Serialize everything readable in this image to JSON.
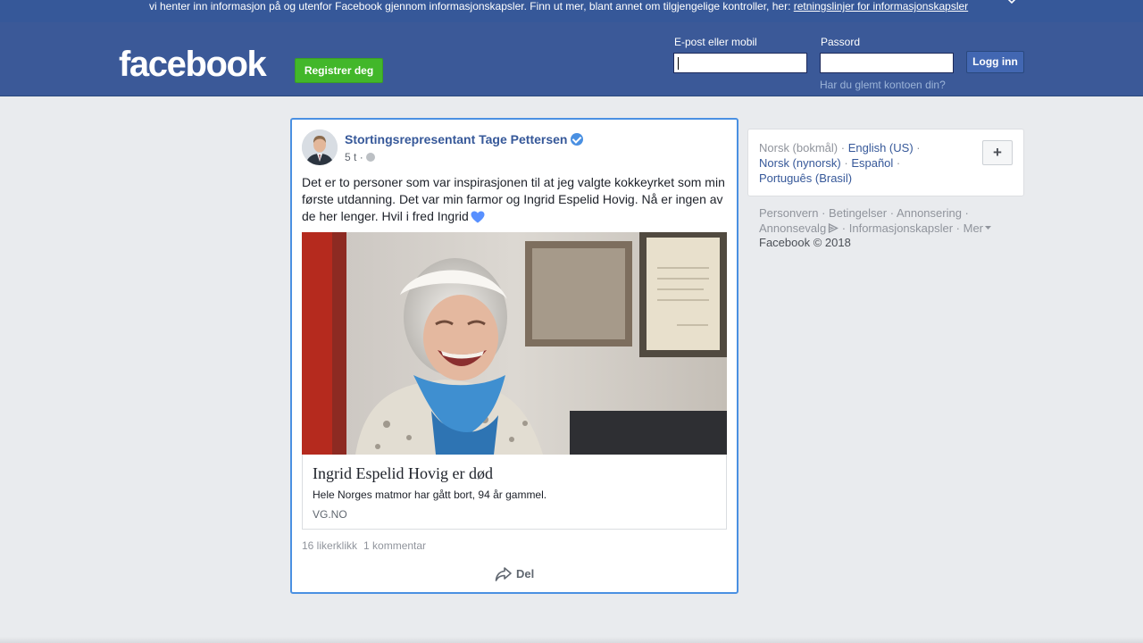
{
  "cookie_banner": {
    "text": "vi henter inn informasjon på og utenfor Facebook gjennom informasjonskapsler. Finn ut mer, blant annet om tilgjengelige kontroller, her: ",
    "link": "retningslinjer for informasjonskapsler",
    "close_icon": "close-icon"
  },
  "header": {
    "logo": "facebook",
    "register_label": "Registrer deg",
    "email_label": "E-post eller mobil",
    "email_value": "",
    "password_label": "Passord",
    "password_value": "",
    "login_label": "Logg inn",
    "forgot_link": "Har du glemt kontoen din?"
  },
  "post": {
    "author": "Stortingsrepresentant Tage Pettersen",
    "verified_icon": "verified-badge-icon",
    "time": "5 t",
    "separator": "·",
    "privacy_icon": "globe-icon",
    "text": "Det er to personer som var inspirasjonen til at jeg valgte kokkeyrket som min første utdanning. Det var min farmor og Ingrid Espelid Hovig. Nå er ingen av de her lenger. Hvil i fred Ingrid",
    "emoji_icon": "blue-heart-icon",
    "link": {
      "title": "Ingrid Espelid Hovig er død",
      "description": "Hele Norges matmor har gått bort, 94 år gammel.",
      "source": "VG.NO"
    },
    "likes": "16 likerklikk",
    "comments": "1 kommentar",
    "share_label": "Del",
    "share_icon": "share-arrow-icon"
  },
  "languages": {
    "current": "Norsk (bokmål)",
    "options": [
      "English (US)",
      "Norsk (nynorsk)",
      "Español",
      "Português (Brasil)"
    ],
    "more_label": "+"
  },
  "footer": {
    "links": [
      "Personvern",
      "Betingelser",
      "Annonsering",
      "Annonsevalg",
      "Informasjonskapsler",
      "Mer"
    ],
    "adchoices_icon": "adchoices-icon",
    "more_caret_icon": "caret-down-icon",
    "copyright": "Facebook © 2018"
  },
  "colors": {
    "brand_blue": "#3b5998",
    "register_green": "#42b72a",
    "link_blue": "#365899",
    "focus_border": "#4a90e2"
  }
}
